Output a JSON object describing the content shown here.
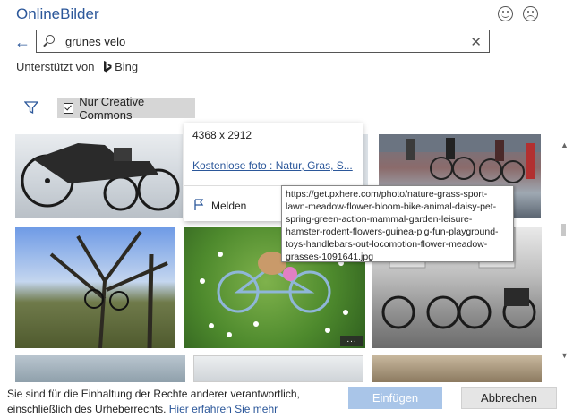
{
  "header": {
    "title": "OnlineBilder",
    "smile_icon": "smile-face-icon",
    "frown_icon": "frown-face-icon"
  },
  "search": {
    "value": "grünes velo",
    "back_icon": "arrow-left-icon",
    "search_icon": "search-icon",
    "clear_icon": "close-icon"
  },
  "powered": {
    "label": "Unterstützt von",
    "brand": "Bing"
  },
  "filter": {
    "icon": "funnel-icon",
    "creative_commons_label": "Nur Creative Commons",
    "creative_commons_checked": true
  },
  "popup": {
    "dimensions": "4368 x 2912",
    "link": "Kostenlose foto : Natur, Gras, S...",
    "report_label": "Melden",
    "report_icon": "flag-icon"
  },
  "tooltip": {
    "lines": [
      "https://get.pxhere.com/photo/nature-grass-sport-",
      "lawn-meadow-flower-bloom-bike-animal-daisy-pet-",
      "spring-green-action-mammal-garden-leisure-",
      "hamster-rodent-flowers-guinea-pig-fun-playground-",
      "toys-handlebars-out-locomotion-flower-meadow-",
      "grasses-1091641.jpg"
    ]
  },
  "images": {
    "more_label": "..."
  },
  "footer": {
    "disclaimer_line1": "Sie sind für die Einhaltung der Rechte anderer verantwortlich,",
    "disclaimer_line2": "einschließlich des Urheberrechts.",
    "learn_more": "Hier erfahren Sie mehr",
    "insert_label": "Einfügen",
    "cancel_label": "Abbrechen"
  },
  "colors": {
    "accent": "#2b579a",
    "insert_button": "#a9c5e8",
    "filter_background": "#d6d6d6"
  }
}
